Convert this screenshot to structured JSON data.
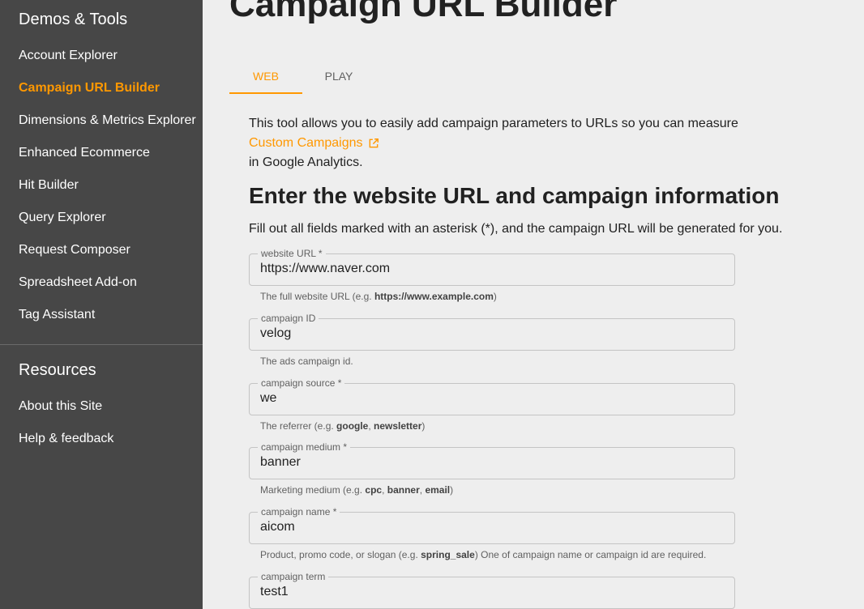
{
  "sidebar": {
    "demos_heading": "Demos & Tools",
    "demos_items": [
      {
        "label": "Account Explorer",
        "active": false
      },
      {
        "label": "Campaign URL Builder",
        "active": true
      },
      {
        "label": "Dimensions & Metrics Explorer",
        "active": false
      },
      {
        "label": "Enhanced Ecommerce",
        "active": false
      },
      {
        "label": "Hit Builder",
        "active": false
      },
      {
        "label": "Query Explorer",
        "active": false
      },
      {
        "label": "Request Composer",
        "active": false
      },
      {
        "label": "Spreadsheet Add-on",
        "active": false
      },
      {
        "label": "Tag Assistant",
        "active": false
      }
    ],
    "resources_heading": "Resources",
    "resources_items": [
      {
        "label": "About this Site"
      },
      {
        "label": "Help & feedback"
      }
    ]
  },
  "main": {
    "title": "Campaign URL Builder",
    "tabs": [
      {
        "label": "WEB",
        "active": true
      },
      {
        "label": "PLAY",
        "active": false
      }
    ],
    "intro_line1": "This tool allows you to easily add campaign parameters to URLs so you can measure",
    "intro_link": "Custom Campaigns",
    "intro_line3": "in Google Analytics.",
    "section_title": "Enter the website URL and campaign information",
    "instructions": "Fill out all fields marked with an asterisk (*), and the campaign URL will be generated for you."
  },
  "fields": [
    {
      "label": "website URL *",
      "value": "https://www.naver.com",
      "helper": [
        [
          "The full website URL (e.g. ",
          false
        ],
        [
          "https://www.example.com",
          true
        ],
        [
          ")",
          false
        ]
      ]
    },
    {
      "label": "campaign ID",
      "value": "velog",
      "helper": [
        [
          "The ads campaign id.",
          false
        ]
      ]
    },
    {
      "label": "campaign source *",
      "value": "we",
      "helper": [
        [
          "The referrer (e.g. ",
          false
        ],
        [
          "google",
          true
        ],
        [
          ", ",
          false
        ],
        [
          "newsletter",
          true
        ],
        [
          ")",
          false
        ]
      ]
    },
    {
      "label": "campaign medium *",
      "value": "banner",
      "helper": [
        [
          "Marketing medium (e.g. ",
          false
        ],
        [
          "cpc",
          true
        ],
        [
          ", ",
          false
        ],
        [
          "banner",
          true
        ],
        [
          ", ",
          false
        ],
        [
          "email",
          true
        ],
        [
          ")",
          false
        ]
      ]
    },
    {
      "label": "campaign name *",
      "value": "aicom",
      "helper": [
        [
          "Product, promo code, or slogan (e.g. ",
          false
        ],
        [
          "spring_sale",
          true
        ],
        [
          ") One of campaign name or campaign id are required.",
          false
        ]
      ]
    },
    {
      "label": "campaign term",
      "value": "test1",
      "helper": []
    }
  ],
  "colors": {
    "accent": "#ff9800",
    "sidebar_bg": "#474747",
    "page_bg": "#eeeeee"
  },
  "icons": {
    "external_link": "external-link-icon"
  }
}
